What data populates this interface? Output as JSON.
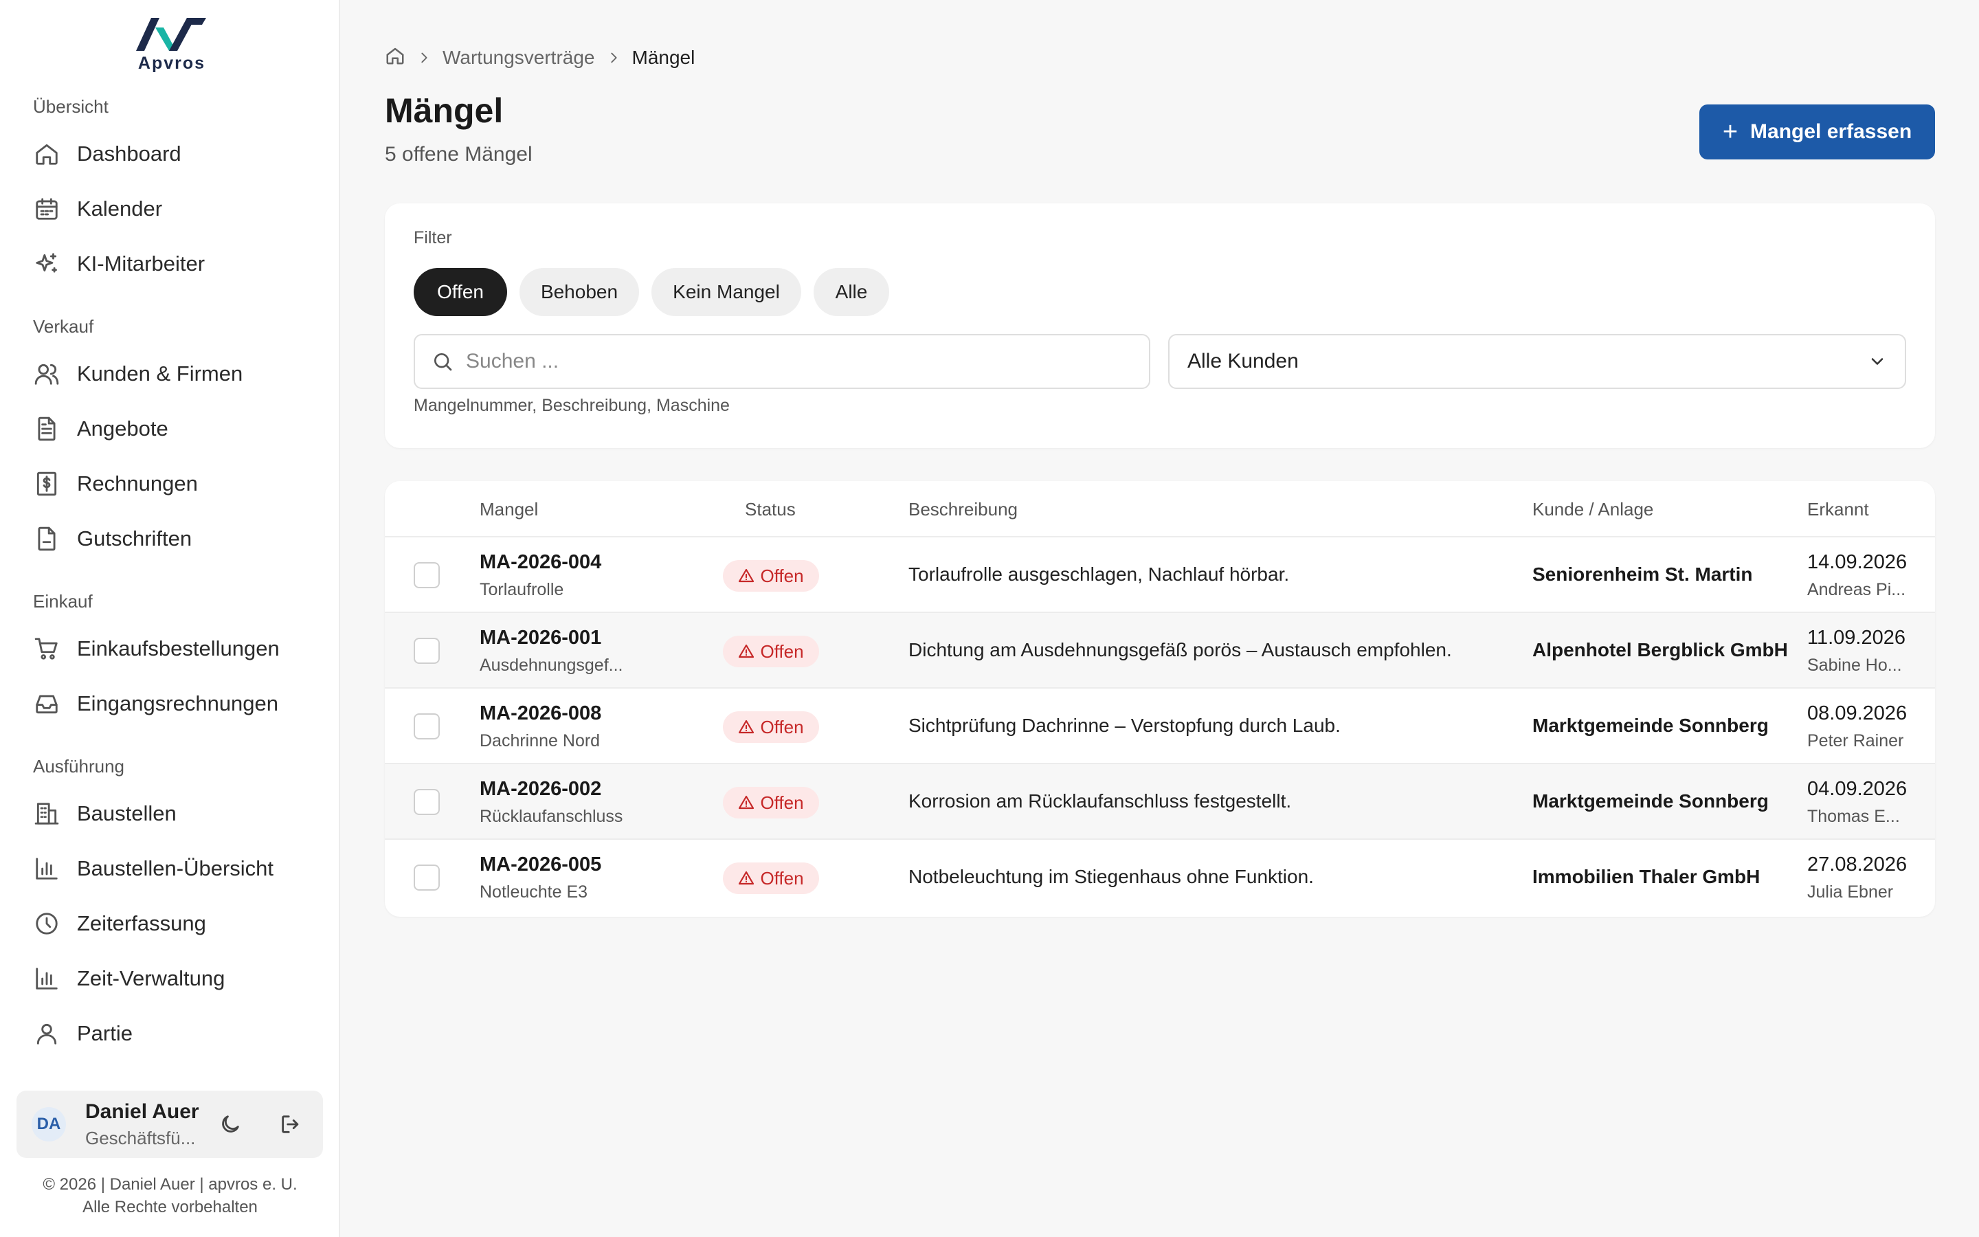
{
  "brand": {
    "name": "Apvros",
    "primary": "#1d5aa8",
    "logo_dark": "#1d2a4a",
    "logo_accent": "#19b5a5"
  },
  "sidebar": {
    "sections": [
      {
        "title": "Übersicht",
        "items": [
          {
            "label": "Dashboard",
            "icon": "home-icon"
          },
          {
            "label": "Kalender",
            "icon": "calendar-icon"
          },
          {
            "label": "KI-Mitarbeiter",
            "icon": "sparkles-icon"
          }
        ]
      },
      {
        "title": "Verkauf",
        "items": [
          {
            "label": "Kunden & Firmen",
            "icon": "users-icon"
          },
          {
            "label": "Angebote",
            "icon": "document-icon"
          },
          {
            "label": "Rechnungen",
            "icon": "invoice-dollar-icon"
          },
          {
            "label": "Gutschriften",
            "icon": "file-icon"
          }
        ]
      },
      {
        "title": "Einkauf",
        "items": [
          {
            "label": "Einkaufsbestellungen",
            "icon": "cart-icon"
          },
          {
            "label": "Eingangsrechnungen",
            "icon": "inbox-icon"
          }
        ]
      },
      {
        "title": "Ausführung",
        "items": [
          {
            "label": "Baustellen",
            "icon": "building-icon"
          },
          {
            "label": "Baustellen-Übersicht",
            "icon": "bar-chart-icon"
          },
          {
            "label": "Zeiterfassung",
            "icon": "clock-icon"
          },
          {
            "label": "Zeit-Verwaltung",
            "icon": "bar-chart-icon"
          },
          {
            "label": "Partie",
            "icon": "user-icon"
          }
        ]
      }
    ]
  },
  "user": {
    "initials": "DA",
    "name": "Daniel Auer",
    "role": "Geschäftsfü..."
  },
  "footer": {
    "line1": "© 2026 | Daniel Auer | apvros e. U.",
    "line2": "Alle Rechte vorbehalten"
  },
  "breadcrumb": {
    "parent": "Wartungsverträge",
    "current": "Mängel"
  },
  "page": {
    "title": "Mängel",
    "subtitle": "5 offene Mängel",
    "action_label": "Mangel erfassen"
  },
  "filter": {
    "label": "Filter",
    "chips": [
      "Offen",
      "Behoben",
      "Kein Mangel",
      "Alle"
    ],
    "active_chip": "Offen",
    "search_placeholder": "Suchen ...",
    "search_value": "",
    "customer_select": "Alle Kunden",
    "hint": "Mangelnummer, Beschreibung, Maschine"
  },
  "table": {
    "headers": {
      "mangel": "Mangel",
      "status": "Status",
      "beschreibung": "Beschreibung",
      "kunde": "Kunde / Anlage",
      "erkannt": "Erkannt"
    },
    "rows": [
      {
        "id": "MA-2026-004",
        "sub": "Torlaufrolle",
        "status": "Offen",
        "desc": "Torlaufrolle ausgeschlagen, Nachlauf hörbar.",
        "kunde": "Seniorenheim St. Martin",
        "date": "14.09.2026",
        "person": "Andreas Pi..."
      },
      {
        "id": "MA-2026-001",
        "sub": "Ausdehnungsgef...",
        "status": "Offen",
        "desc": "Dichtung am Ausdehnungsgefäß porös – Austausch empfohlen.",
        "kunde": "Alpenhotel Bergblick GmbH",
        "date": "11.09.2026",
        "person": "Sabine Ho..."
      },
      {
        "id": "MA-2026-008",
        "sub": "Dachrinne Nord",
        "status": "Offen",
        "desc": "Sichtprüfung Dachrinne – Verstopfung durch Laub.",
        "kunde": "Marktgemeinde Sonnberg",
        "date": "08.09.2026",
        "person": "Peter Rainer"
      },
      {
        "id": "MA-2026-002",
        "sub": "Rücklaufanschluss",
        "status": "Offen",
        "desc": "Korrosion am Rücklaufanschluss festgestellt.",
        "kunde": "Marktgemeinde Sonnberg",
        "date": "04.09.2026",
        "person": "Thomas E..."
      },
      {
        "id": "MA-2026-005",
        "sub": "Notleuchte E3",
        "status": "Offen",
        "desc": "Notbeleuchtung im Stiegenhaus ohne Funktion.",
        "kunde": "Immobilien Thaler GmbH",
        "date": "27.08.2026",
        "person": "Julia Ebner"
      }
    ]
  }
}
